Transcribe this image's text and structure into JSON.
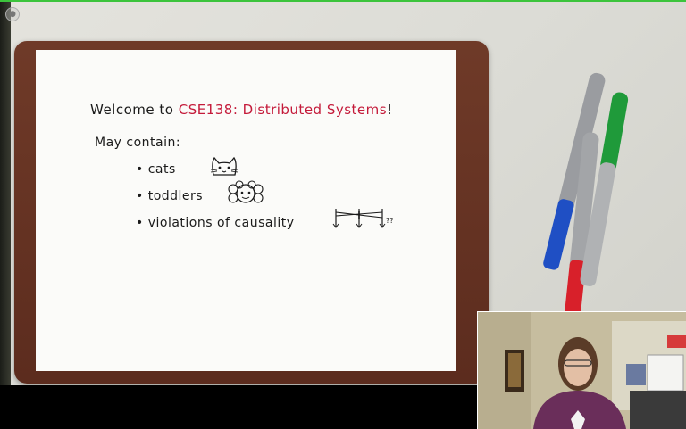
{
  "whiteboard": {
    "welcome_prefix": "Welcome to",
    "welcome_course": "CSE138: Distributed Systems",
    "welcome_suffix": "!",
    "may_contain": "May contain:",
    "items": [
      {
        "label": "cats"
      },
      {
        "label": "toddlers"
      },
      {
        "label": "violations of causality"
      }
    ],
    "bullet_glyph": "•",
    "causality_marks": "??"
  },
  "markers": [
    {
      "color": "#8a8c8e",
      "cap_color": "#1f4fc4",
      "name": "blue-marker"
    },
    {
      "color": "#8a8c8e",
      "cap_color": "#d8202a",
      "name": "red-marker"
    },
    {
      "color": "#8a8c8e",
      "cap_color": "#1f9a3a",
      "name": "green-marker"
    }
  ],
  "colors": {
    "accent_red": "#c41a3a",
    "frame_border": "#3cc43c",
    "board_frame": "#6f3a28"
  }
}
